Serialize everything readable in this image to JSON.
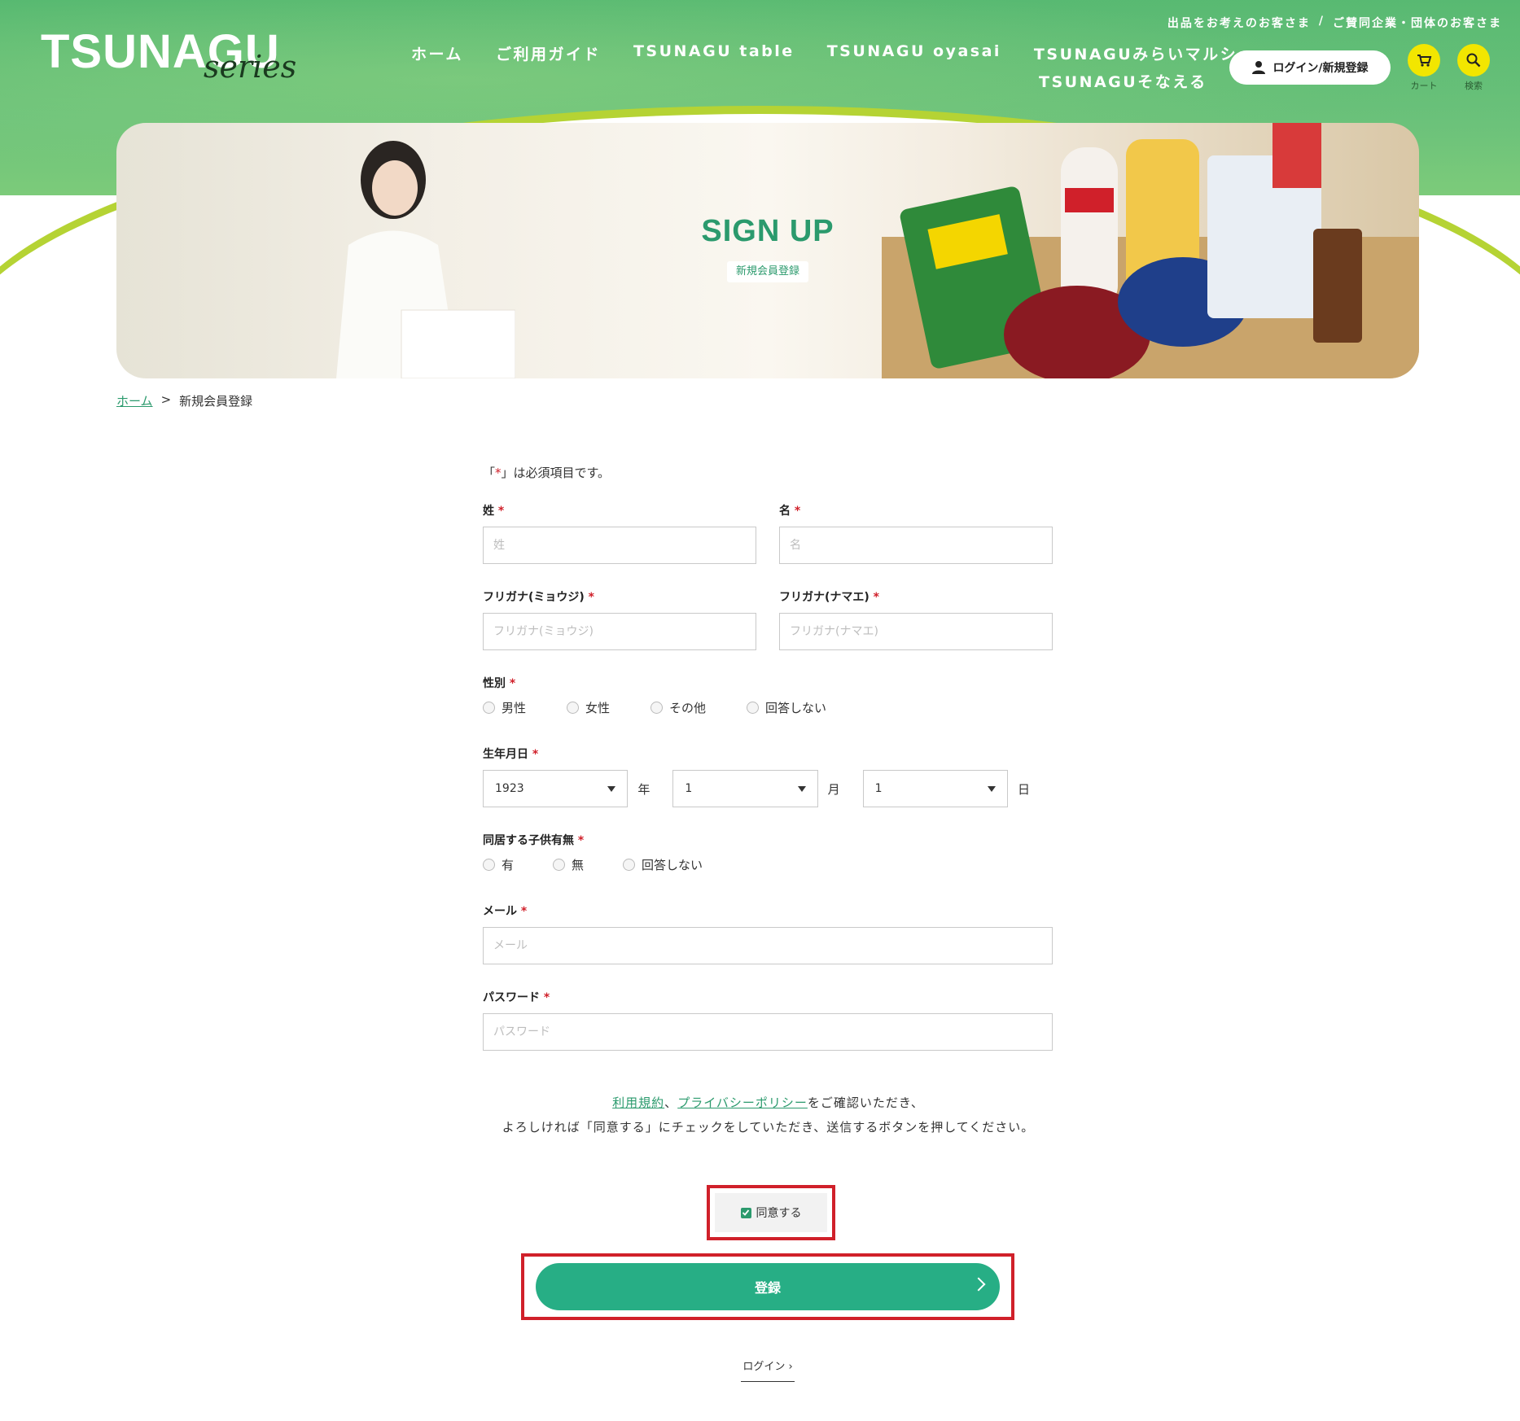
{
  "header": {
    "logo_main": "TSUNAGU",
    "logo_sub": "series",
    "top_links": [
      "出品をお考えのお客さま",
      "ご賛同企業・団体のお客さま"
    ],
    "top_sep": "/",
    "nav": [
      "ホーム",
      "ご利用ガイド",
      "TSUNAGU table",
      "TSUNAGU oyasai",
      "TSUNAGUみらいマルシェ"
    ],
    "nav_second_line": "TSUNAGUそなえる",
    "login_label": "ログイン/新規登録",
    "cart_label": "カート",
    "search_label": "検索",
    "accent_yellow": "#f2e600",
    "brand_green": "#2b9a6d"
  },
  "hero": {
    "title": "SIGN UP",
    "subtitle": "新規会員登録"
  },
  "breadcrumb": {
    "home": "ホーム",
    "separator": ">",
    "current": "新規会員登録"
  },
  "form": {
    "required_note_pre": "「",
    "required_note_mark": "*",
    "required_note_post": "」は必須項目です。",
    "required_mark": "*",
    "last_name": {
      "label": "姓",
      "placeholder": "姓",
      "value": ""
    },
    "first_name": {
      "label": "名",
      "placeholder": "名",
      "value": ""
    },
    "kana_last": {
      "label": "フリガナ(ミョウジ)",
      "placeholder": "フリガナ(ミョウジ)",
      "value": ""
    },
    "kana_first": {
      "label": "フリガナ(ナマエ)",
      "placeholder": "フリガナ(ナマエ)",
      "value": ""
    },
    "gender": {
      "label": "性別",
      "options": [
        "男性",
        "女性",
        "その他",
        "回答しない"
      ]
    },
    "birthdate": {
      "label": "生年月日",
      "year": "1923",
      "year_unit": "年",
      "month": "1",
      "month_unit": "月",
      "day": "1",
      "day_unit": "日"
    },
    "children": {
      "label": "同居する子供有無",
      "options": [
        "有",
        "無",
        "回答しない"
      ]
    },
    "email": {
      "label": "メール",
      "placeholder": "メール",
      "value": ""
    },
    "password": {
      "label": "パスワード",
      "placeholder": "パスワード",
      "value": ""
    }
  },
  "terms": {
    "link1": "利用規約",
    "sep": "、",
    "link2": "プライバシーポリシー",
    "line1_tail": "をご確認いただき、",
    "line2": "よろしければ「同意する」にチェックをしていただき、送信するボタンを押してください。"
  },
  "agree": {
    "label": "同意する",
    "checked": true
  },
  "submit": {
    "label": "登録"
  },
  "login_link": {
    "label": "ログイン"
  }
}
